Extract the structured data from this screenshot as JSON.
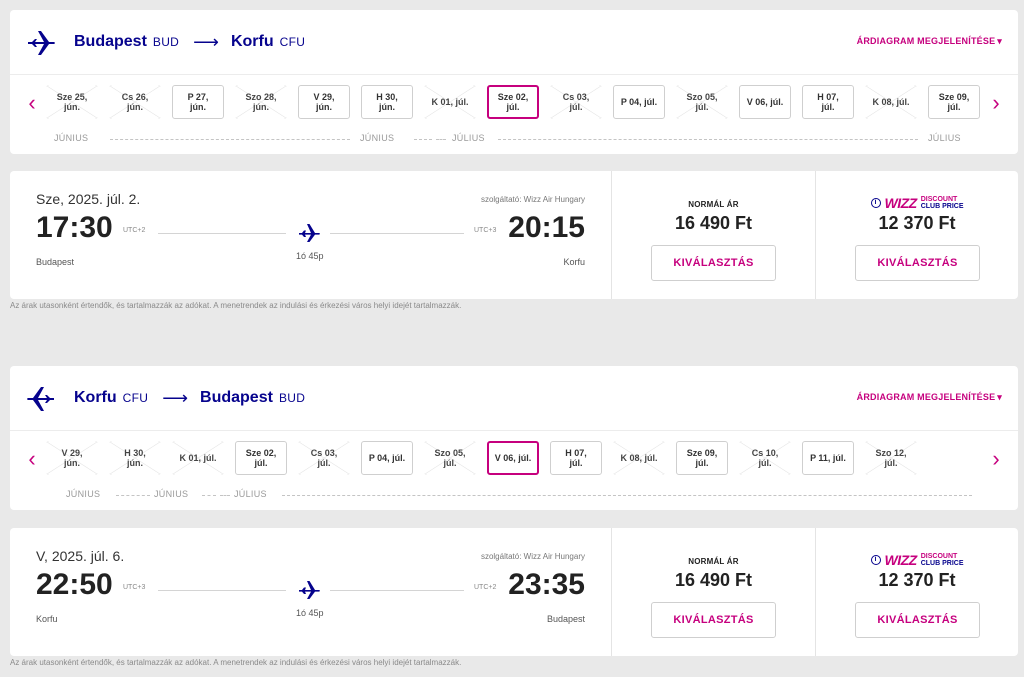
{
  "outbound": {
    "from_city": "Budapest",
    "from_code": "BUD",
    "to_city": "Korfu",
    "to_code": "CFU",
    "chart_link": "ÁRDIAGRAM MEGJELENÍTÉSE",
    "dates": [
      {
        "l1": "Sze 25,",
        "l2": "jún.",
        "state": "noflight"
      },
      {
        "l1": "Cs 26,",
        "l2": "jún.",
        "state": "noflight"
      },
      {
        "l1": "P 27,",
        "l2": "jún.",
        "state": "available"
      },
      {
        "l1": "Szo 28,",
        "l2": "jún.",
        "state": "noflight"
      },
      {
        "l1": "V 29,",
        "l2": "jún.",
        "state": "available"
      },
      {
        "l1": "H 30,",
        "l2": "jún.",
        "state": "available"
      },
      {
        "l1": "K 01, júl.",
        "l2": "",
        "state": "noflight"
      },
      {
        "l1": "Sze 02,",
        "l2": "júl.",
        "state": "selected"
      },
      {
        "l1": "Cs 03,",
        "l2": "júl.",
        "state": "noflight"
      },
      {
        "l1": "P 04, júl.",
        "l2": "",
        "state": "available"
      },
      {
        "l1": "Szo 05,",
        "l2": "júl.",
        "state": "noflight"
      },
      {
        "l1": "V 06, júl.",
        "l2": "",
        "state": "available"
      },
      {
        "l1": "H 07,",
        "l2": "júl.",
        "state": "available"
      },
      {
        "l1": "K 08, júl.",
        "l2": "",
        "state": "noflight"
      },
      {
        "l1": "Sze 09,",
        "l2": "júl.",
        "state": "available"
      }
    ],
    "months": {
      "m1": "JÚNIUS",
      "m2": "JÚNIUS",
      "m3": "JÚLIUS",
      "m4": "JÚLIUS"
    },
    "flight": {
      "date": "Sze, 2025. júl. 2.",
      "operator": "szolgáltató: Wizz Air Hungary",
      "dep_time": "17:30",
      "dep_utc": "UTC+2",
      "dep_city": "Budapest",
      "arr_time": "20:15",
      "arr_utc": "UTC+3",
      "arr_city": "Korfu",
      "duration": "1ó 45p",
      "normal_label": "NORMÁL ÁR",
      "normal_price": "16 490 Ft",
      "club_price": "12 370 Ft",
      "select_label": "KIVÁLASZTÁS"
    }
  },
  "inbound": {
    "from_city": "Korfu",
    "from_code": "CFU",
    "to_city": "Budapest",
    "to_code": "BUD",
    "chart_link": "ÁRDIAGRAM MEGJELENÍTÉSE",
    "dates": [
      {
        "l1": "V 29,",
        "l2": "jún.",
        "state": "noflight"
      },
      {
        "l1": "H 30,",
        "l2": "jún.",
        "state": "noflight"
      },
      {
        "l1": "K 01, júl.",
        "l2": "",
        "state": "noflight"
      },
      {
        "l1": "Sze 02,",
        "l2": "júl.",
        "state": "available"
      },
      {
        "l1": "Cs 03,",
        "l2": "júl.",
        "state": "noflight"
      },
      {
        "l1": "P 04, júl.",
        "l2": "",
        "state": "available"
      },
      {
        "l1": "Szo 05,",
        "l2": "júl.",
        "state": "noflight"
      },
      {
        "l1": "V 06, júl.",
        "l2": "",
        "state": "selected"
      },
      {
        "l1": "H 07,",
        "l2": "júl.",
        "state": "available"
      },
      {
        "l1": "K 08, júl.",
        "l2": "",
        "state": "noflight"
      },
      {
        "l1": "Sze 09,",
        "l2": "júl.",
        "state": "available"
      },
      {
        "l1": "Cs 10,",
        "l2": "júl.",
        "state": "noflight"
      },
      {
        "l1": "P 11, júl.",
        "l2": "",
        "state": "available"
      },
      {
        "l1": "Szo 12,",
        "l2": "júl.",
        "state": "noflight"
      }
    ],
    "months": {
      "m1": "JÚNIUS",
      "m2": "JÚNIUS",
      "m3": "JÚLIUS"
    },
    "flight": {
      "date": "V, 2025. júl. 6.",
      "operator": "szolgáltató: Wizz Air Hungary",
      "dep_time": "22:50",
      "dep_utc": "UTC+3",
      "dep_city": "Korfu",
      "arr_time": "23:35",
      "arr_utc": "UTC+2",
      "arr_city": "Budapest",
      "duration": "1ó 45p",
      "normal_label": "NORMÁL ÁR",
      "normal_price": "16 490 Ft",
      "club_price": "12 370 Ft",
      "select_label": "KIVÁLASZTÁS"
    }
  },
  "club": {
    "brand": "WIZZ",
    "line1": "DISCOUNT",
    "line2": "CLUB PRICE"
  },
  "price_note": "Az árak utasonként értendők, és tartalmazzák az adókat. A menetrendek az indulási és érkezési város helyi idejét tartalmazzák.",
  "colors": {
    "navy": "#06038d",
    "magenta": "#c6007e"
  }
}
